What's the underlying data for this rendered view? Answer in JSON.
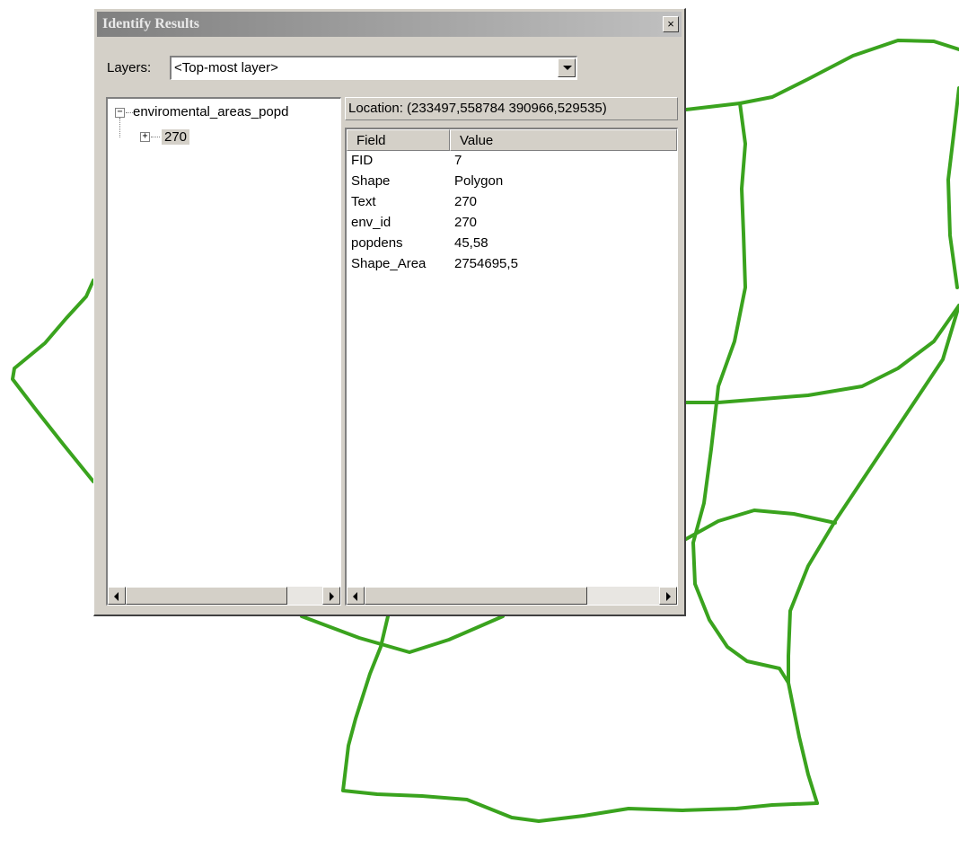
{
  "window": {
    "title": "Identify Results",
    "close_glyph": "×"
  },
  "layers": {
    "label": "Layers:",
    "selected": "<Top-most layer>"
  },
  "tree": {
    "root_label": "enviromental_areas_popd",
    "root_expander": "−",
    "child_label": "270",
    "child_expander": "+"
  },
  "location": {
    "text": "Location: (233497,558784 390966,529535)"
  },
  "attributes": {
    "columns": [
      "Field",
      "Value"
    ],
    "rows": [
      {
        "field": "FID",
        "value": "7"
      },
      {
        "field": "Shape",
        "value": "Polygon"
      },
      {
        "field": "Text",
        "value": "270"
      },
      {
        "field": "env_id",
        "value": "270"
      },
      {
        "field": "popdens",
        "value": "45,58"
      },
      {
        "field": "Shape_Area",
        "value": "2754695,5"
      }
    ]
  },
  "map": {
    "line_color": "#3aa31e",
    "background": "#ffffff"
  },
  "icons": {
    "scroll_left": "scroll-left-arrow-icon",
    "scroll_right": "scroll-right-arrow-icon",
    "dropdown": "chevron-down-icon",
    "close": "close-icon"
  }
}
